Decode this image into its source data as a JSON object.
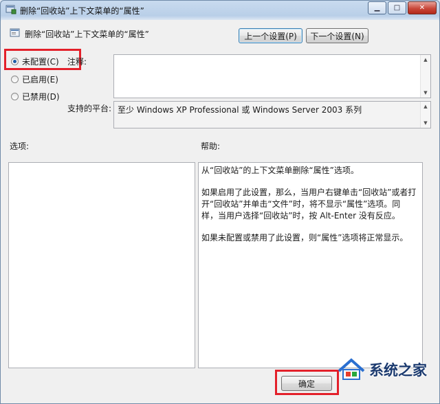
{
  "window": {
    "title": "删除“回收站”上下文菜单的“属性”"
  },
  "header": {
    "setting_name": "删除“回收站”上下文菜单的“属性”",
    "prev_label": "上一个设置(P)",
    "next_label": "下一个设置(N)"
  },
  "state": {
    "options": [
      {
        "label": "未配置(C)",
        "selected": true
      },
      {
        "label": "已启用(E)",
        "selected": false
      },
      {
        "label": "已禁用(D)",
        "selected": false
      }
    ]
  },
  "comment": {
    "label": "注释:",
    "value": ""
  },
  "platform": {
    "label": "支持的平台:",
    "value": "至少 Windows XP Professional 或 Windows Server 2003 系列"
  },
  "options_panel": {
    "label": "选项:"
  },
  "help_panel": {
    "label": "帮助:",
    "paragraphs": [
      "从“回收站”的上下文菜单删除“属性”选项。",
      "如果启用了此设置，那么，当用户右键单击“回收站”或者打开“回收站”并单击“文件”时，将不显示“属性”选项。同样，当用户选择“回收站”时，按 Alt-Enter 没有反应。",
      "如果未配置或禁用了此设置，则“属性”选项将正常显示。"
    ]
  },
  "footer": {
    "ok_label": "确定"
  },
  "watermark": {
    "text": "系统之家"
  },
  "colors": {
    "highlight": "#e3202a",
    "radio_dot": "#1e5fa8"
  }
}
